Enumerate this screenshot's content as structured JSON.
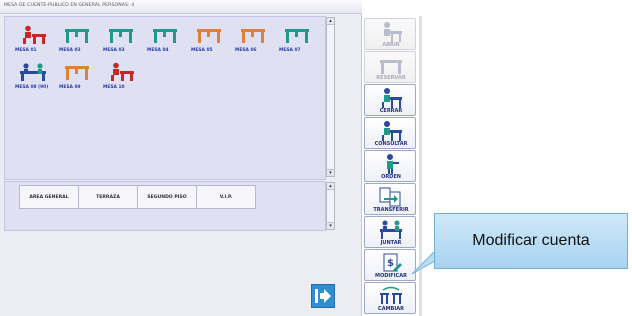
{
  "window": {
    "title": "MESA DE CUENTE-PUBLICO EN GENERAL  PERSONAS: 4"
  },
  "tables": [
    {
      "label": "MESA 01",
      "state": "occupied"
    },
    {
      "label": "MESA 02",
      "state": "free"
    },
    {
      "label": "MESA 03",
      "state": "free"
    },
    {
      "label": "MESA 04",
      "state": "free"
    },
    {
      "label": "MESA 05",
      "state": "reserved"
    },
    {
      "label": "MESA 06",
      "state": "reserved"
    },
    {
      "label": "MESA 07",
      "state": "free"
    },
    {
      "label": "MESA 08 (90)",
      "state": "joined"
    },
    {
      "label": "MESA 09",
      "state": "reserved"
    },
    {
      "label": "MESA 10",
      "state": "occupied"
    }
  ],
  "sections": [
    "AREA GENERAL",
    "TERRAZA",
    "SEGUNDO PISO",
    "V.I.P."
  ],
  "actions": [
    {
      "label": "ABRIR",
      "icon": "open-table-icon",
      "enabled": false
    },
    {
      "label": "RESERVAR",
      "icon": "reserve-table-icon",
      "enabled": false
    },
    {
      "label": "CERRAR",
      "icon": "close-table-icon",
      "enabled": true
    },
    {
      "label": "CONSULTAR",
      "icon": "consult-table-icon",
      "enabled": true
    },
    {
      "label": "ORDEN",
      "icon": "order-icon",
      "enabled": true
    },
    {
      "label": "TRANSFERIR",
      "icon": "transfer-icon",
      "enabled": true
    },
    {
      "label": "JUNTAR",
      "icon": "join-tables-icon",
      "enabled": true
    },
    {
      "label": "MODIFICAR",
      "icon": "modify-bill-icon",
      "enabled": true
    },
    {
      "label": "CAMBIAR",
      "icon": "change-table-icon",
      "enabled": true
    }
  ],
  "callout": {
    "text": "Modificar cuenta"
  },
  "colors": {
    "occupied": "#c62828",
    "free": "#1f9a8a",
    "reserved": "#e0803a",
    "label": "#2b3da8",
    "accent": "#2e8fd3"
  }
}
